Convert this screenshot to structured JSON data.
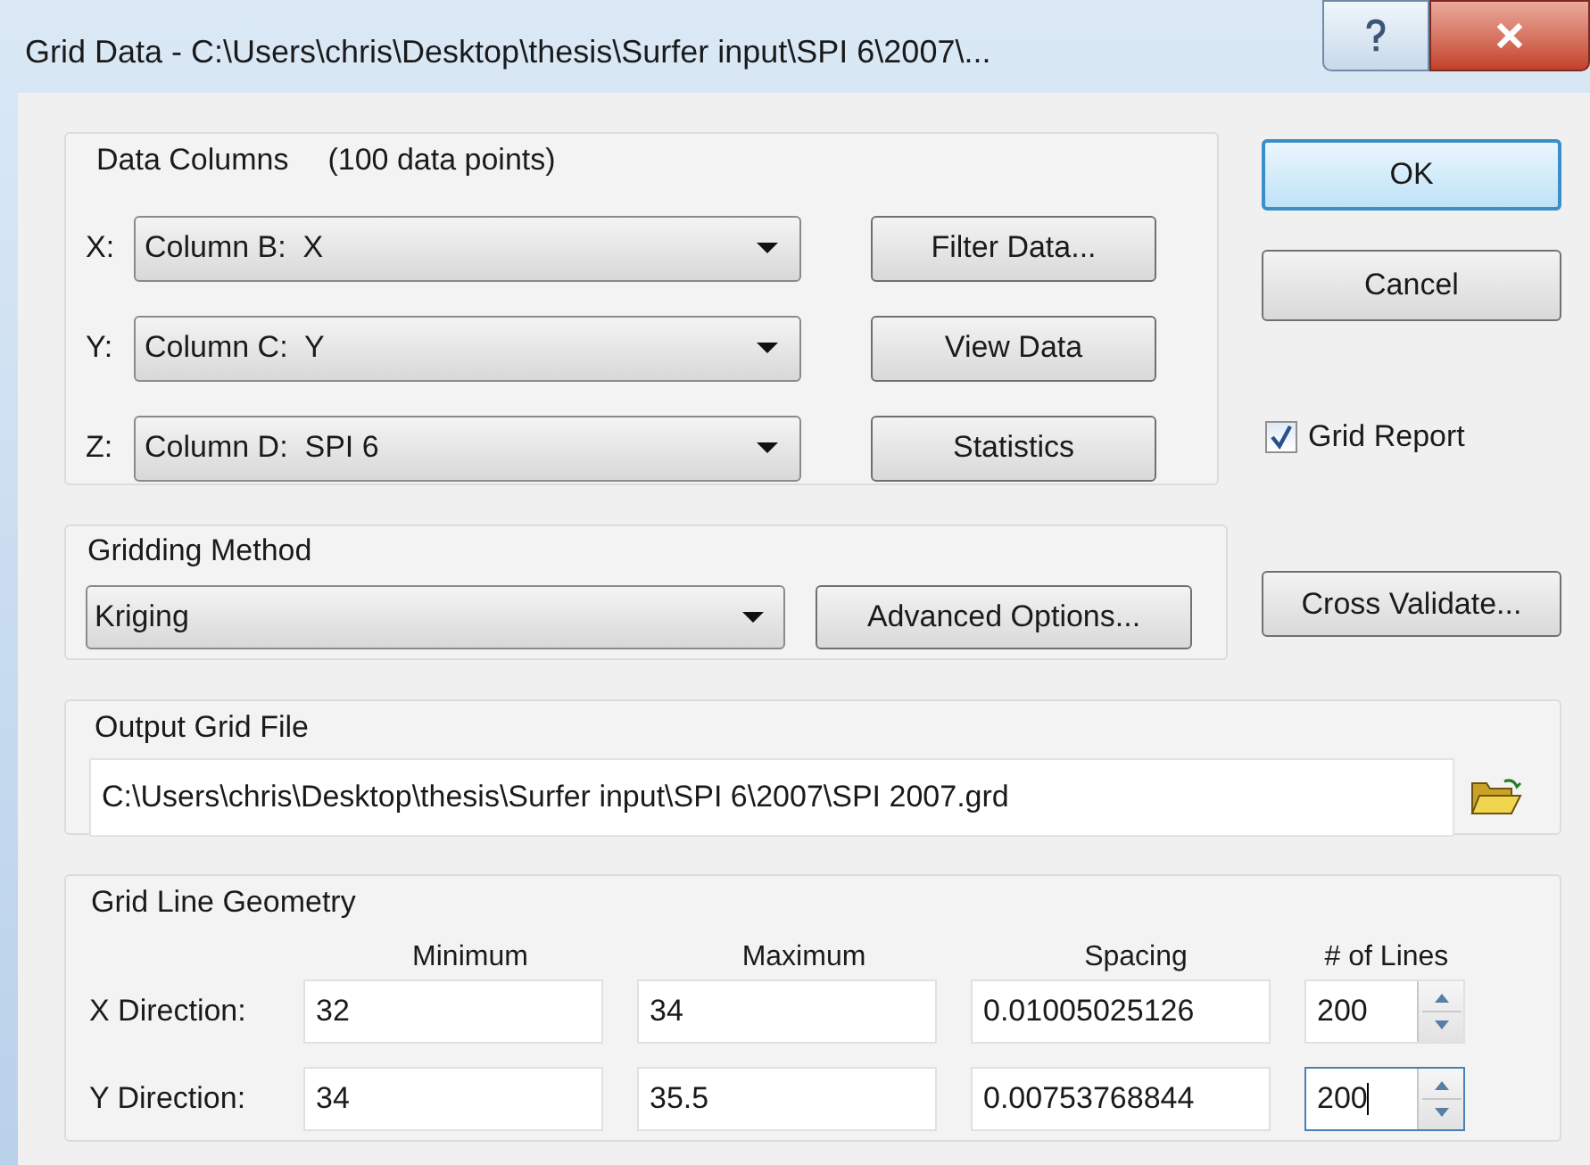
{
  "window": {
    "title": "Grid Data - C:\\Users\\chris\\Desktop\\thesis\\Surfer input\\SPI 6\\2007\\..."
  },
  "data_columns": {
    "title": "Data Columns",
    "count": "(100 data points)",
    "rows": [
      {
        "axis": "X:",
        "column": "Column B:  X",
        "button": "Filter Data..."
      },
      {
        "axis": "Y:",
        "column": "Column C:  Y",
        "button": "View Data"
      },
      {
        "axis": "Z:",
        "column": "Column D:  SPI 6",
        "button": "Statistics"
      }
    ]
  },
  "buttons": [
    {
      "label": "OK",
      "focused": true
    },
    {
      "label": "Cancel",
      "focused": false
    }
  ],
  "grid_report": {
    "label": "Grid Report",
    "checked": true
  },
  "gridding_method": {
    "title": "Gridding Method",
    "method": "Kriging",
    "button": "Advanced Options..."
  },
  "cross_validate": "Cross Validate...",
  "output_grid_file": {
    "title": "Output Grid File",
    "path": "C:\\Users\\chris\\Desktop\\thesis\\Surfer input\\SPI 6\\2007\\SPI 2007.grd"
  },
  "grid_line_geometry": {
    "title": "Grid Line Geometry",
    "columns": [
      "Minimum",
      "Maximum",
      "Spacing",
      "# of Lines"
    ],
    "rows": [
      {
        "label": "X Direction:",
        "minimum": "32",
        "maximum": "34",
        "spacing": "0.01005025126",
        "lines": "200",
        "focused": false
      },
      {
        "label": "Y Direction:",
        "minimum": "34",
        "maximum": "35.5",
        "spacing": "0.00753768844",
        "lines": "200",
        "focused": true
      }
    ]
  }
}
